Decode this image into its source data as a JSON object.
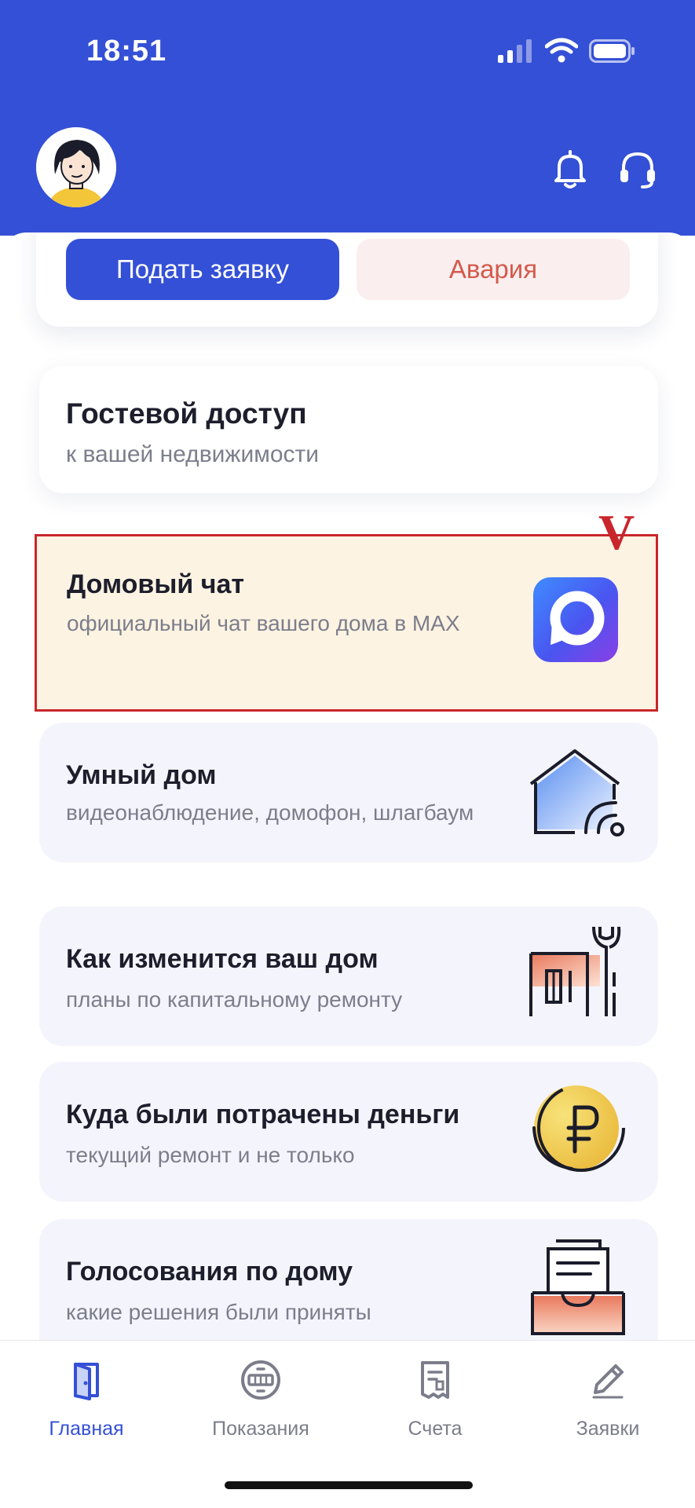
{
  "status_bar": {
    "time": "18:51"
  },
  "header": {
    "avatar_icon": "profile-avatar-icon",
    "notifications_icon": "bell-icon",
    "support_icon": "headset-icon"
  },
  "actions": {
    "submit_label": "Подать заявку",
    "alarm_label": "Авария"
  },
  "cards": {
    "guest": {
      "title": "Гостевой доступ",
      "subtitle": "к вашей недвижимости"
    },
    "chat": {
      "title": "Домовый чат",
      "subtitle": "официальный чат вашего дома в MAX",
      "annotation": "V",
      "icon": "max-messenger-icon"
    },
    "smart_home": {
      "title": "Умный дом",
      "subtitle": "видеонаблюдение, домофон, шлагбаум",
      "icon": "smart-house-icon"
    },
    "repair": {
      "title": "Как изменится ваш дом",
      "subtitle": "планы по капитальному ремонту",
      "icon": "repair-wrench-icon"
    },
    "money": {
      "title": "Куда были потрачены деньги",
      "subtitle": "текущий ремонт и не только",
      "icon": "ruble-coin-icon"
    },
    "voting": {
      "title": "Голосования по дому",
      "subtitle": "какие решения были приняты",
      "icon": "ballot-box-icon"
    }
  },
  "tabbar": {
    "items": [
      {
        "label": "Главная",
        "icon": "door-icon",
        "active": true
      },
      {
        "label": "Показания",
        "icon": "meter-icon",
        "active": false
      },
      {
        "label": "Счета",
        "icon": "receipt-icon",
        "active": false
      },
      {
        "label": "Заявки",
        "icon": "pencil-icon",
        "active": false
      }
    ]
  },
  "colors": {
    "brand_blue": "#3450d6",
    "alarm_red": "#d35a4c",
    "annotation_red": "#c8262c",
    "chat_card_bg": "#fdf3e2",
    "card_bg": "#f4f5fc"
  }
}
